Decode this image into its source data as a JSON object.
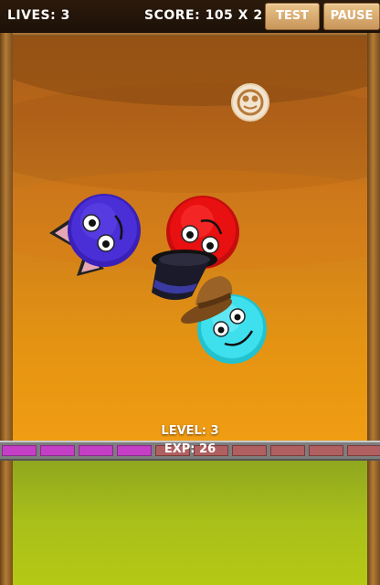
{
  "hud": {
    "lives": "LIVES: 3",
    "score": "SCORE: 105 X 2",
    "test_button": "TEST",
    "pause_button": "PAUSE"
  },
  "progress": {
    "level": "LEVEL: 3",
    "exp": "EXP: 26",
    "exp_bar": {
      "segments_total": 10,
      "segments_filled": 4
    }
  },
  "creatures": [
    {
      "id": "purple-cat-creature",
      "color": "#4a2ed6",
      "accessory": "cat-ears"
    },
    {
      "id": "red-creature",
      "color": "#e81010",
      "accessory": "top-hat"
    },
    {
      "id": "cyan-creature",
      "color": "#3fe0ee",
      "accessory": "bowler-hat"
    }
  ],
  "colors": {
    "sky_top": "#a95e17",
    "sky_bottom": "#f09d13",
    "ground": "#a9c01a",
    "exp_filled": "#c43fc6",
    "exp_empty": "#b06060"
  }
}
